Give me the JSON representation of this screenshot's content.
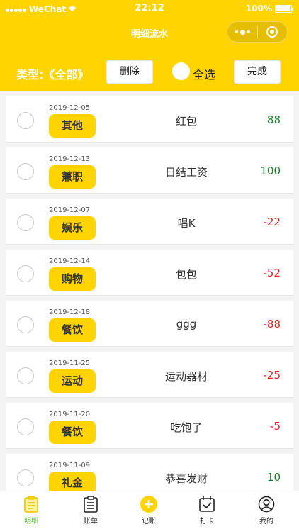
{
  "status": {
    "carrier": "WeChat",
    "time": "22:12",
    "battery": "100%"
  },
  "nav": {
    "title": "明细流水"
  },
  "toolbar": {
    "type_label": "类型:《全部》",
    "delete_label": "删除",
    "select_all_label": "全选",
    "done_label": "完成"
  },
  "colors": {
    "accent": "#ffd400",
    "income": "#1b7d2a",
    "expense": "#e02020",
    "tab_active": "#5bbf3a"
  },
  "records": [
    {
      "date": "2019-12-05",
      "category": "其他",
      "note": "红包",
      "amount": "88",
      "sign": "pos"
    },
    {
      "date": "2019-12-13",
      "category": "兼职",
      "note": "日结工资",
      "amount": "100",
      "sign": "pos"
    },
    {
      "date": "2019-12-07",
      "category": "娱乐",
      "note": "唱K",
      "amount": "-22",
      "sign": "neg"
    },
    {
      "date": "2019-12-14",
      "category": "购物",
      "note": "包包",
      "amount": "-52",
      "sign": "neg"
    },
    {
      "date": "2019-12-18",
      "category": "餐饮",
      "note": "ggg",
      "amount": "-88",
      "sign": "neg"
    },
    {
      "date": "2019-11-25",
      "category": "运动",
      "note": "运动器材",
      "amount": "-25",
      "sign": "neg"
    },
    {
      "date": "2019-11-20",
      "category": "餐饮",
      "note": "吃饱了",
      "amount": "-5",
      "sign": "neg"
    },
    {
      "date": "2019-11-09",
      "category": "礼金",
      "note": "恭喜发财",
      "amount": "10",
      "sign": "pos"
    }
  ],
  "tabs": [
    {
      "label": "明细",
      "icon": "clipboard-icon",
      "active": true
    },
    {
      "label": "账单",
      "icon": "bill-icon",
      "active": false
    },
    {
      "label": "记账",
      "icon": "plus-circle-icon",
      "active": false
    },
    {
      "label": "打卡",
      "icon": "calendar-check-icon",
      "active": false
    },
    {
      "label": "我的",
      "icon": "user-icon",
      "active": false
    }
  ]
}
